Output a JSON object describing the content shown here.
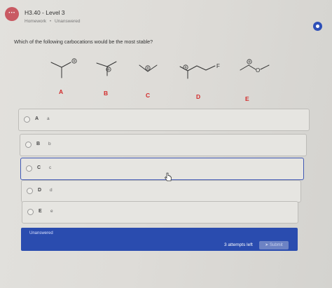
{
  "header": {
    "badge": "···",
    "title": "H3.40 - Level 3",
    "subtitle_type": "Homework",
    "subtitle_status": "Unanswered"
  },
  "question": {
    "text": "Which of the following carbocations would be the most stable?",
    "structures": [
      {
        "label": "A"
      },
      {
        "label": "B"
      },
      {
        "label": "C"
      },
      {
        "label": "D",
        "atom": "F"
      },
      {
        "label": "E",
        "atom": "O"
      }
    ]
  },
  "options": [
    {
      "letter": "A",
      "text": "a"
    },
    {
      "letter": "B",
      "text": "b"
    },
    {
      "letter": "C",
      "text": "c"
    },
    {
      "letter": "D",
      "text": "d"
    },
    {
      "letter": "E",
      "text": "e"
    }
  ],
  "footer": {
    "status": "Unanswered",
    "attempts": "3 attempts left",
    "submit_label": "Submit"
  },
  "colors": {
    "accent": "#2a4caf",
    "label_red": "#d22a2a",
    "badge": "#c95a63"
  }
}
